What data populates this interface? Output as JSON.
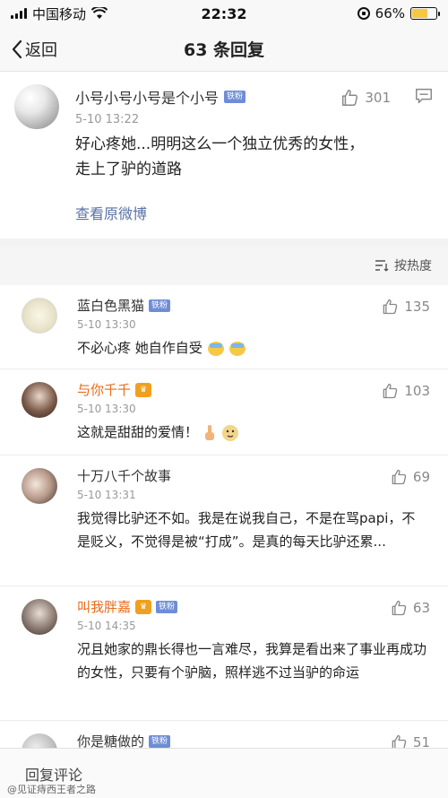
{
  "status_bar": {
    "carrier": "中国移动",
    "time": "22:32",
    "battery": "66%",
    "battery_level": 0.66
  },
  "nav": {
    "back_label": "返回",
    "title": "63 条回复"
  },
  "main_post": {
    "author": "小号小号小号是个小号",
    "badge": "铁粉",
    "time": "5-10 13:22",
    "text_line1": "好心疼她...明明这么一个独立优秀的女性，",
    "text_line2": "走上了驴的道路",
    "likes": "301",
    "view_link": "查看原微博"
  },
  "sort": {
    "label": "按热度"
  },
  "comments": [
    {
      "author": "蓝白色黑猫",
      "badge": "铁粉",
      "time": "5-10 13:30",
      "text": "不必心疼 她自作自受",
      "likes": "135"
    },
    {
      "author": "与你千千",
      "time": "5-10 13:30",
      "text": "这就是甜甜的爱情！",
      "likes": "103"
    },
    {
      "author": "十万八千个故事",
      "time": "5-10 13:31",
      "text": "我觉得比驴还不如。我是在说我自己，不是在骂papi，不是贬义，不觉得是被“打成”。是真的每天比驴还累...",
      "likes": "69"
    },
    {
      "author": "叫我胖嘉",
      "badge": "铁粉",
      "time": "5-10 14:35",
      "text": "况且她家的鼎长得也一言难尽，我算是看出来了事业再成功的女性，只要有个驴脑，照样逃不过当驴的命运",
      "likes": "63"
    },
    {
      "author": "你是糖做的",
      "badge": "铁粉",
      "likes": "51"
    }
  ],
  "bottom": {
    "reply_placeholder": "回复评论",
    "watermark": "@见证痔西王者之路"
  },
  "colors": {
    "link": "#5a72a6",
    "vip_name": "#e86b1c",
    "badge": "#6f8dd6"
  }
}
